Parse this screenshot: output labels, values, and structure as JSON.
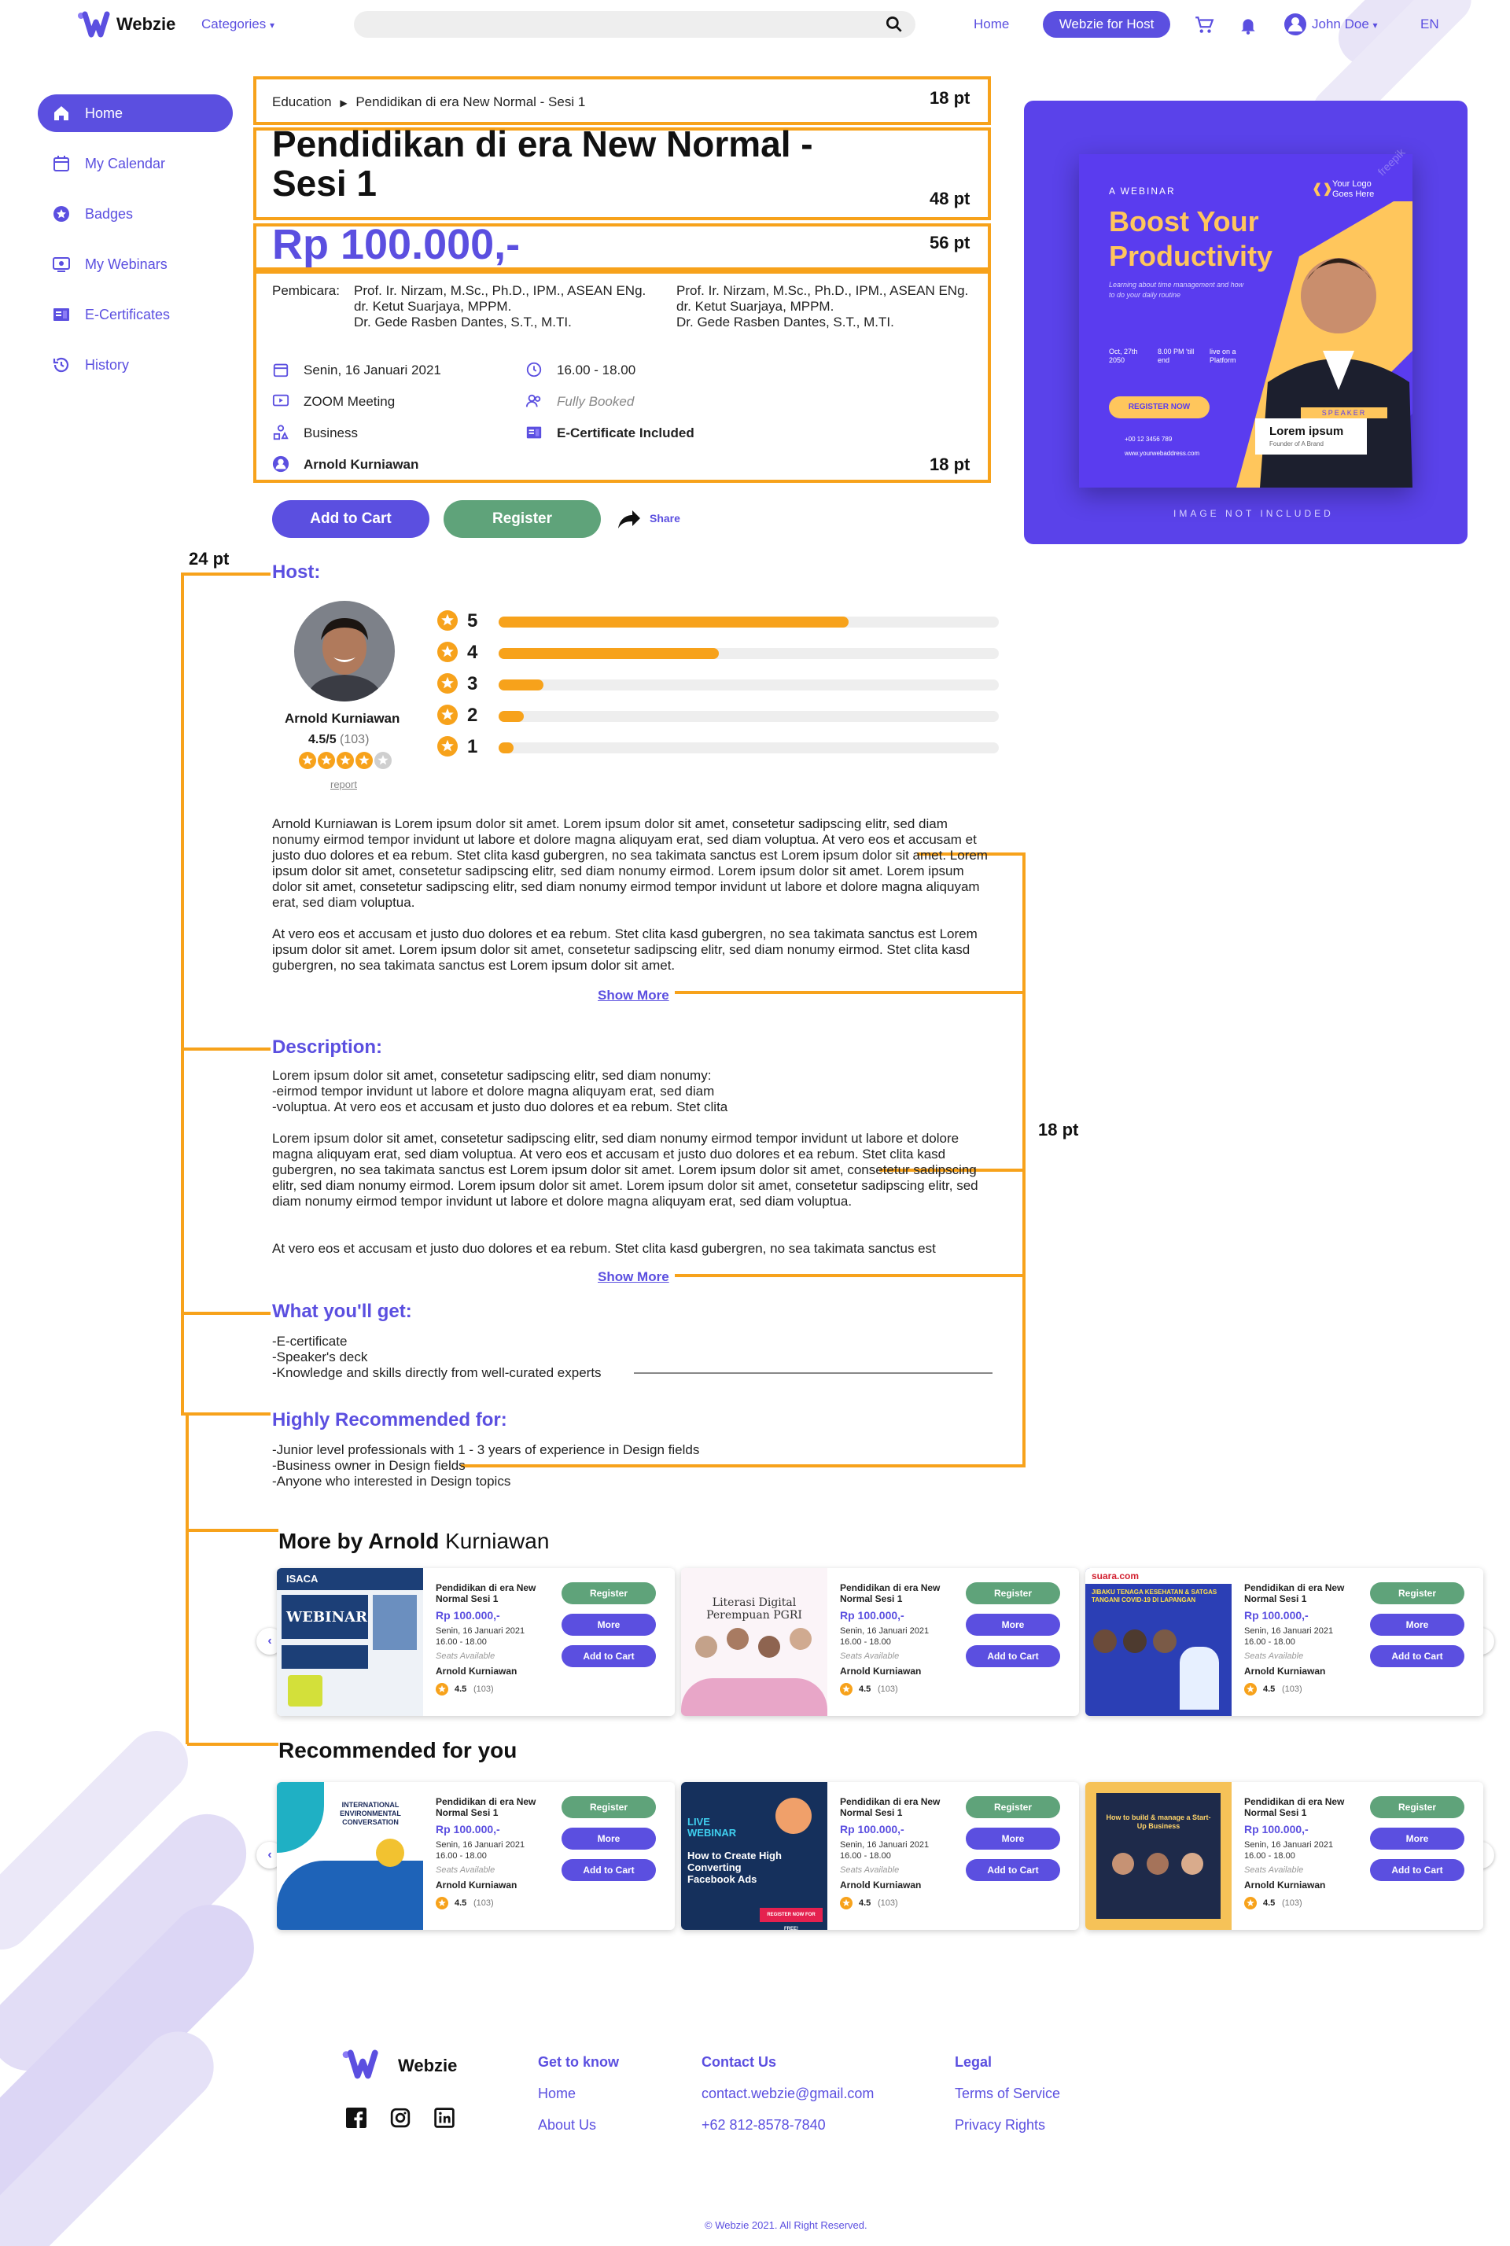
{
  "nav": {
    "brand": "Webzie",
    "categories": "Categories",
    "home": "Home",
    "host_button": "Webzie for Host",
    "user": "John Doe",
    "lang": "EN"
  },
  "sidebar": {
    "items": [
      {
        "label": "Home",
        "icon": "home-icon"
      },
      {
        "label": "My Calendar",
        "icon": "calendar-icon"
      },
      {
        "label": "Badges",
        "icon": "badge-icon"
      },
      {
        "label": "My Webinars",
        "icon": "webinar-icon"
      },
      {
        "label": "E-Certificates",
        "icon": "certificate-icon"
      },
      {
        "label": "History",
        "icon": "history-icon"
      }
    ]
  },
  "annotations": {
    "pt18": "18 pt",
    "pt48": "48 pt",
    "pt56": "56 pt",
    "pt24": "24 pt"
  },
  "event": {
    "breadcrumb_parent": "Education",
    "breadcrumb_current": "Pendidikan di era New Normal - Sesi 1",
    "title_line1": "Pendidikan di era New Normal -",
    "title_line2": "Sesi 1",
    "price": "Rp 100.000,-",
    "speakers_label": "Pembicara:",
    "speakers_col1": [
      "Prof. Ir. Nirzam, M.Sc., Ph.D., IPM., ASEAN ENg.",
      "dr. Ketut Suarjaya, MPPM.",
      "Dr. Gede Rasben Dantes, S.T., M.TI."
    ],
    "speakers_col2": [
      "Prof. Ir. Nirzam, M.Sc., Ph.D., IPM., ASEAN ENg.",
      "dr. Ketut Suarjaya, MPPM.",
      "Dr. Gede Rasben Dantes, S.T., M.TI."
    ],
    "date": "Senin, 16 Januari 2021",
    "time": "16.00 - 18.00",
    "platform": "ZOOM Meeting",
    "availability": "Fully Booked",
    "category": "Business",
    "certificate": "E-Certificate Included",
    "host": "Arnold Kurniawan",
    "add_to_cart": "Add to Cart",
    "register": "Register",
    "share": "Share"
  },
  "poster": {
    "kicker": "A WEBINAR",
    "headline_1": "Boost Your",
    "headline_2": "Productivity",
    "sub": "Learning about time management and how to do your daily routine",
    "logo_line1": "Your Logo",
    "logo_line2": "Goes Here",
    "date": "Oct, 27th 2050",
    "time": "8.00 PM 'till end",
    "live": "live on a Platform",
    "cta": "REGISTER NOW",
    "speaker_tag": "SPEAKER",
    "speaker_name": "Lorem ipsum",
    "speaker_role": "Founder of A Brand",
    "phone": "+00 12 3456 789",
    "site": "www.yourwebaddress.com",
    "footer": "IMAGE NOT INCLUDED",
    "watermark": "freepik"
  },
  "host_section": {
    "title": "Host:",
    "name": "Arnold Kurniawan",
    "score": "4.5/5",
    "count": "(103)",
    "report": "report",
    "ratings": [
      {
        "star": "5",
        "fraction": 0.7
      },
      {
        "star": "4",
        "fraction": 0.44
      },
      {
        "star": "3",
        "fraction": 0.09
      },
      {
        "star": "2",
        "fraction": 0.05
      },
      {
        "star": "1",
        "fraction": 0.03
      }
    ],
    "bio_p1": "Arnold Kurniawan is Lorem ipsum dolor sit amet. Lorem ipsum dolor sit amet, consetetur sadipscing elitr, sed diam nonumy eirmod tempor invidunt ut labore et dolore magna aliquyam erat, sed diam voluptua. At vero eos et accusam et justo duo dolores et ea rebum. Stet clita kasd gubergren, no sea takimata sanctus est Lorem ipsum dolor sit amet. Lorem ipsum dolor sit amet, consetetur sadipscing elitr, sed diam nonumy eirmod. Lorem ipsum dolor sit amet. Lorem ipsum dolor sit amet, consetetur sadipscing elitr, sed diam nonumy eirmod tempor invidunt ut labore et dolore magna aliquyam erat, sed diam voluptua.",
    "bio_p2": "At vero eos et accusam et justo duo dolores et ea rebum. Stet clita kasd gubergren, no sea takimata sanctus est Lorem ipsum dolor sit amet. Lorem ipsum dolor sit amet, consetetur sadipscing elitr, sed diam nonumy eirmod. Stet clita kasd gubergren, no sea takimata sanctus est Lorem ipsum dolor sit amet.",
    "show_more": "Show More"
  },
  "description": {
    "title": "Description:",
    "p1_l1": "Lorem ipsum dolor sit amet, consetetur sadipscing elitr, sed diam nonumy:",
    "p1_l2": "-eirmod tempor invidunt ut labore et dolore magna aliquyam erat, sed diam",
    "p1_l3": "-voluptua. At vero eos et accusam et justo duo dolores et ea rebum. Stet clita",
    "p2": "Lorem ipsum dolor sit amet, consetetur sadipscing elitr, sed diam nonumy eirmod tempor invidunt ut labore et dolore magna aliquyam erat, sed diam voluptua. At vero eos et accusam et justo duo dolores et ea rebum. Stet clita kasd gubergren, no sea takimata sanctus est Lorem ipsum dolor sit amet. Lorem ipsum dolor sit amet, consetetur sadipscing elitr, sed diam nonumy eirmod. Lorem ipsum dolor sit amet. Lorem ipsum dolor sit amet, consetetur sadipscing elitr, sed diam nonumy eirmod tempor invidunt ut labore et dolore magna aliquyam erat, sed diam voluptua.",
    "p3": "At vero eos et accusam et justo duo dolores et ea rebum. Stet clita kasd gubergren, no sea takimata sanctus est",
    "show_more": "Show More"
  },
  "what_you_get": {
    "title": "What you'll get:",
    "items": [
      "-E-certificate",
      "-Speaker's deck",
      "-Knowledge and skills directly from well-curated experts"
    ]
  },
  "recommended_for": {
    "title": "Highly Recommended for:",
    "items": [
      "-Junior level professionals with 1 - 3 years of experience in Design fields",
      "-Business owner in Design fields",
      "-Anyone who interested in Design topics"
    ]
  },
  "more_by": {
    "title_bold": "More by Arnold",
    "title_rest": " Kurniawan"
  },
  "recommended": {
    "title": "Recommended for you"
  },
  "card": {
    "title": "Pendidikan di era New Normal Sesi 1",
    "price": "Rp 100.000,-",
    "date": "Senin, 16 Januari 2021",
    "time": "16.00 - 18.00",
    "seats": "Seats Available",
    "host": "Arnold Kurniawan",
    "rating": "4.5",
    "count": "(103)",
    "register": "Register",
    "more": "More",
    "add": "Add to Cart"
  },
  "thumbs": {
    "t1": {
      "brand": "ISACA",
      "word": "WEBINAR"
    },
    "t2": {
      "line1": "Literasi Digital",
      "line2": "Perempuan PGRI"
    },
    "t3": {
      "brand": "suara.com",
      "head": "JIBAKU TENAGA KESEHATAN & SATGAS TANGANI COVID-19 DI LAPANGAN"
    },
    "t4": {
      "head": "INTERNATIONAL ENVIRONMENTAL CONVERSATION"
    },
    "t5": {
      "tag": "LIVE WEBINAR",
      "head": "How to Create High Converting Facebook Ads",
      "cta": "REGISTER NOW FOR FREE!"
    },
    "t6": {
      "head": "How to build & manage a Start-Up Business"
    }
  },
  "footer": {
    "brand": "Webzie",
    "get_to_know": "Get to know",
    "home": "Home",
    "about": "About Us",
    "contact": "Contact Us",
    "email": "contact.webzie@gmail.com",
    "phone": "+62 812-8578-7840",
    "legal": "Legal",
    "terms": "Terms of Service",
    "privacy": "Privacy Rights",
    "copyright": "© Webzie 2021. All Right Reserved."
  },
  "colors": {
    "accent": "#5b4fe0",
    "annotation": "#f7a21b",
    "register": "#5fa37a"
  }
}
